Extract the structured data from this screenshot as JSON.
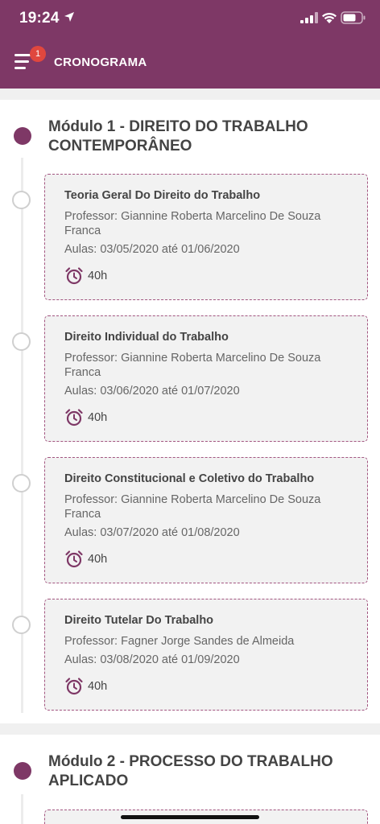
{
  "status_bar": {
    "time": "19:24"
  },
  "header": {
    "title": "CRONOGRAMA",
    "notification_count": "1"
  },
  "modules": [
    {
      "title": "Módulo 1 - DIREITO DO TRABALHO CONTEMPORÂNEO",
      "courses": [
        {
          "title": "Teoria Geral Do Direito do Trabalho",
          "professor": "Professor: Giannine Roberta Marcelino De Souza Franca",
          "dates": "Aulas: 03/05/2020 até 01/06/2020",
          "hours": "40h"
        },
        {
          "title": "Direito Individual do Trabalho",
          "professor": "Professor: Giannine Roberta Marcelino De Souza Franca",
          "dates": "Aulas: 03/06/2020 até 01/07/2020",
          "hours": "40h"
        },
        {
          "title": "Direito Constitucional e Coletivo do Trabalho",
          "professor": "Professor: Giannine Roberta Marcelino De Souza Franca",
          "dates": "Aulas: 03/07/2020 até 01/08/2020",
          "hours": "40h"
        },
        {
          "title": "Direito Tutelar Do Trabalho",
          "professor": "Professor: Fagner Jorge Sandes de Almeida",
          "dates": "Aulas: 03/08/2020 até 01/09/2020",
          "hours": "40h"
        }
      ]
    },
    {
      "title": "Módulo 2 - PROCESSO DO TRABALHO APLICADO",
      "courses": []
    }
  ],
  "colors": {
    "brand": "#7e3866",
    "badge": "#e0473e",
    "card_border": "#a35580"
  }
}
